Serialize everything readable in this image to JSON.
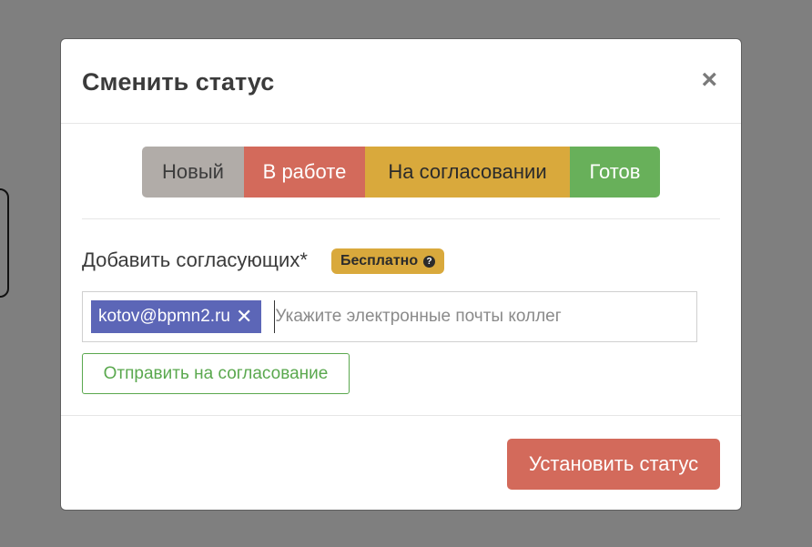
{
  "modal": {
    "title": "Сменить статус",
    "close_icon": "close-icon",
    "close_glyph": "×"
  },
  "statuses": [
    {
      "label": "Новый",
      "color": "#b1aca8"
    },
    {
      "label": "В работе",
      "color": "#d36a5b"
    },
    {
      "label": "На согласовании",
      "color": "#d9a93c"
    },
    {
      "label": "Готов",
      "color": "#68b05a"
    }
  ],
  "approvers": {
    "label": "Добавить согласующих*",
    "badge": {
      "text": "Бесплатно",
      "color": "#d9a93c",
      "icon": "question-circle-icon",
      "icon_glyph": "?"
    },
    "tags": [
      {
        "text": "kotov@bpmn2.ru",
        "color": "#5c66b7",
        "remove_glyph": "✕"
      }
    ],
    "input_value": "",
    "placeholder": "Укажите электронные почты коллег",
    "send_button": {
      "label": "Отправить на согласование",
      "color": "#5aa84e"
    }
  },
  "footer": {
    "set_status_button": {
      "label": "Установить статус",
      "color": "#d36a5b"
    }
  }
}
